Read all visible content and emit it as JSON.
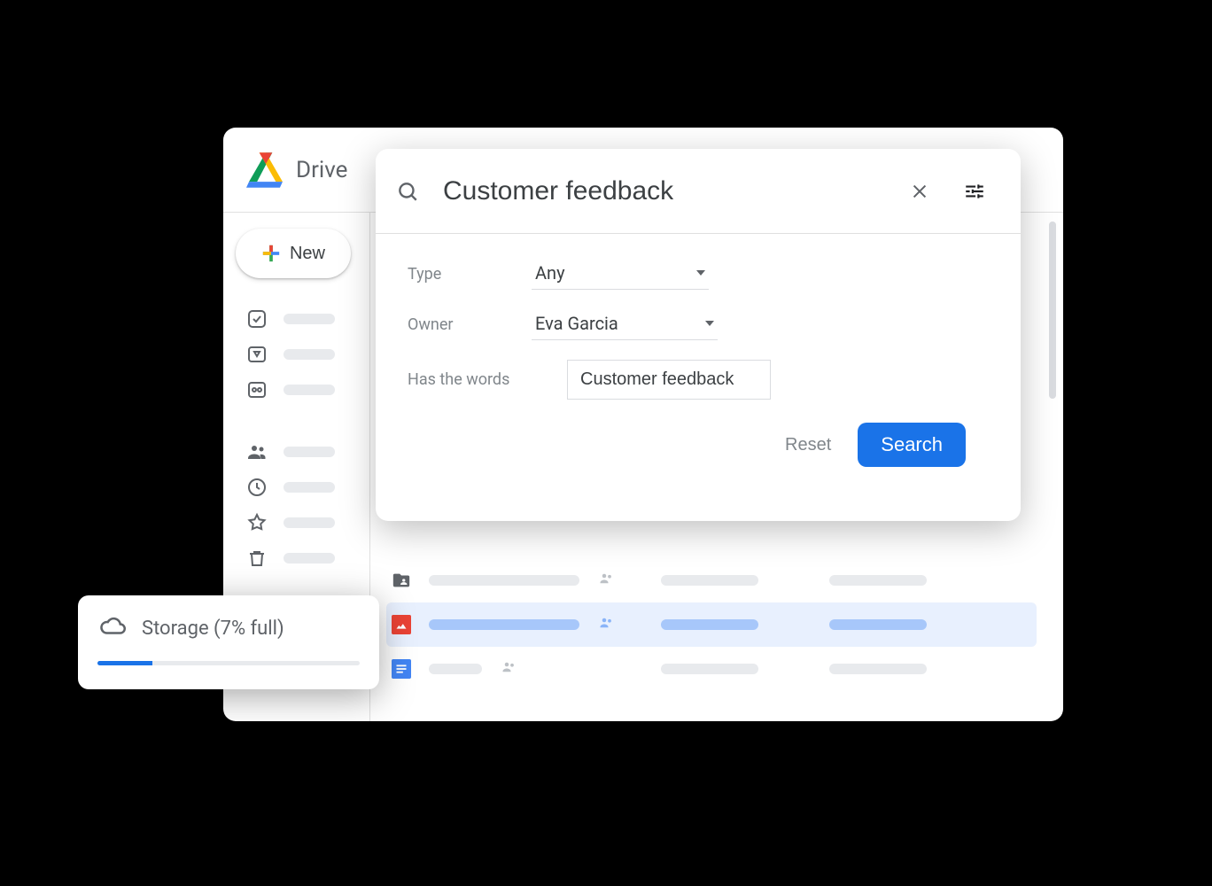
{
  "app": {
    "title": "Drive"
  },
  "sidebar": {
    "new_label": "New"
  },
  "search": {
    "query": "Customer feedback",
    "filters": {
      "type_label": "Type",
      "type_value": "Any",
      "owner_label": "Owner",
      "owner_value": "Eva Garcia",
      "words_label": "Has the words",
      "words_value": "Customer feedback"
    },
    "reset_label": "Reset",
    "search_label": "Search"
  },
  "storage": {
    "label": "Storage (7% full)",
    "percent": 7
  },
  "colors": {
    "accent": "#1a73e8"
  }
}
